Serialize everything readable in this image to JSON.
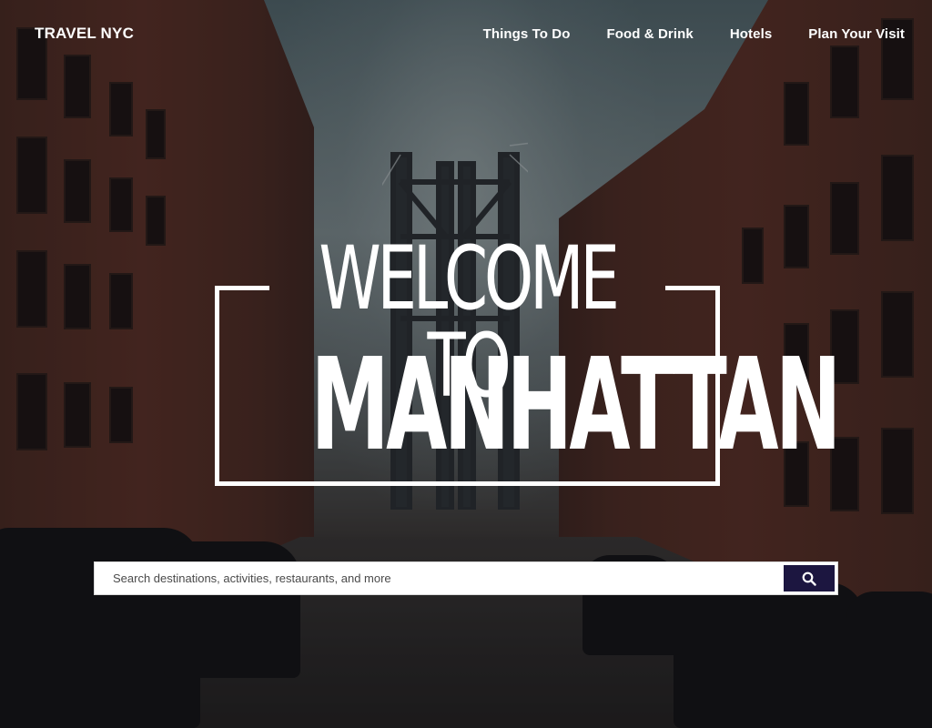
{
  "header": {
    "logo": "TRAVEL NYC",
    "nav": [
      {
        "label": "Things To Do"
      },
      {
        "label": "Food & Drink"
      },
      {
        "label": "Hotels"
      },
      {
        "label": "Plan Your Visit"
      }
    ]
  },
  "hero": {
    "title_line1": "WELCOME TO",
    "title_line2": "MANHATTAN"
  },
  "search": {
    "placeholder": "Search destinations, activities, restaurants, and more",
    "value": "",
    "button_icon": "search-icon"
  },
  "colors": {
    "search_button_bg": "#1c1640",
    "text": "#ffffff",
    "frame": "#ffffff"
  }
}
